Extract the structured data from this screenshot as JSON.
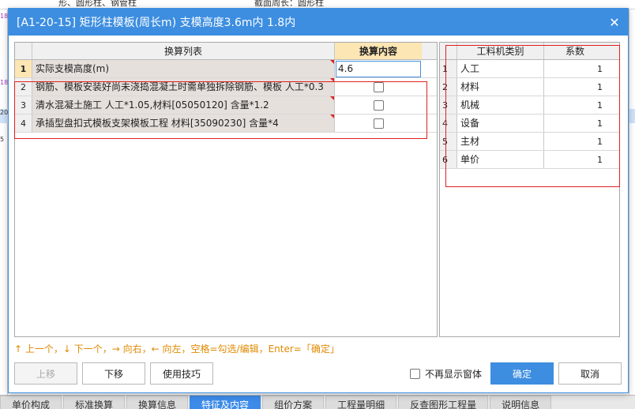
{
  "background": {
    "top_text_1": "形、圆形柱、钢管柱",
    "top_text_2": "截面周长：圆形柱",
    "left_marks": [
      "18",
      "18",
      "20",
      "5"
    ],
    "bottom_tabs": [
      "单价构成",
      "标准换算",
      "换算信息",
      "特征及内容",
      "组价方案",
      "工程量明细",
      "反查图形工程量",
      "说明信息"
    ],
    "active_tab": "特征及内容"
  },
  "dialog": {
    "title": "[A1-20-15] 矩形柱模板(周长m) 支模高度3.6m内 1.8内",
    "close": "✕",
    "left_grid": {
      "col_list": "换算列表",
      "col_content": "换算内容",
      "rows": [
        {
          "num": "1",
          "name": "实际支模高度(m)",
          "value": "4.6",
          "type": "input"
        },
        {
          "num": "2",
          "name": "钢筋、模板安装好尚未浇捣混凝土时需单独拆除钢筋、模板 人工*0.3",
          "type": "checkbox"
        },
        {
          "num": "3",
          "name": "清水混凝土施工 人工*1.05,材料[05050120] 含量*1.2",
          "type": "checkbox"
        },
        {
          "num": "4",
          "name": "承插型盘扣式模板支架模板工程 材料[35090230] 含量*4",
          "type": "checkbox"
        }
      ]
    },
    "right_grid": {
      "col_type": "工料机类别",
      "col_coef": "系数",
      "rows": [
        {
          "num": "1",
          "name": "人工",
          "coef": "1"
        },
        {
          "num": "2",
          "name": "材料",
          "coef": "1"
        },
        {
          "num": "3",
          "name": "机械",
          "coef": "1"
        },
        {
          "num": "4",
          "name": "设备",
          "coef": "1"
        },
        {
          "num": "5",
          "name": "主材",
          "coef": "1"
        },
        {
          "num": "6",
          "name": "单价",
          "coef": "1"
        }
      ]
    },
    "hint": "↑ 上一个，↓ 下一个，→ 向右，← 向左，空格=勾选/编辑，Enter=「确定」",
    "buttons": {
      "move_up": "上移",
      "move_down": "下移",
      "tips": "使用技巧",
      "no_show": "不再显示窗体",
      "ok": "确定",
      "cancel": "取消"
    },
    "colors": {
      "accent": "#3d8ee0",
      "highlight_box": "#e02020",
      "hint": "#e08a00"
    }
  }
}
